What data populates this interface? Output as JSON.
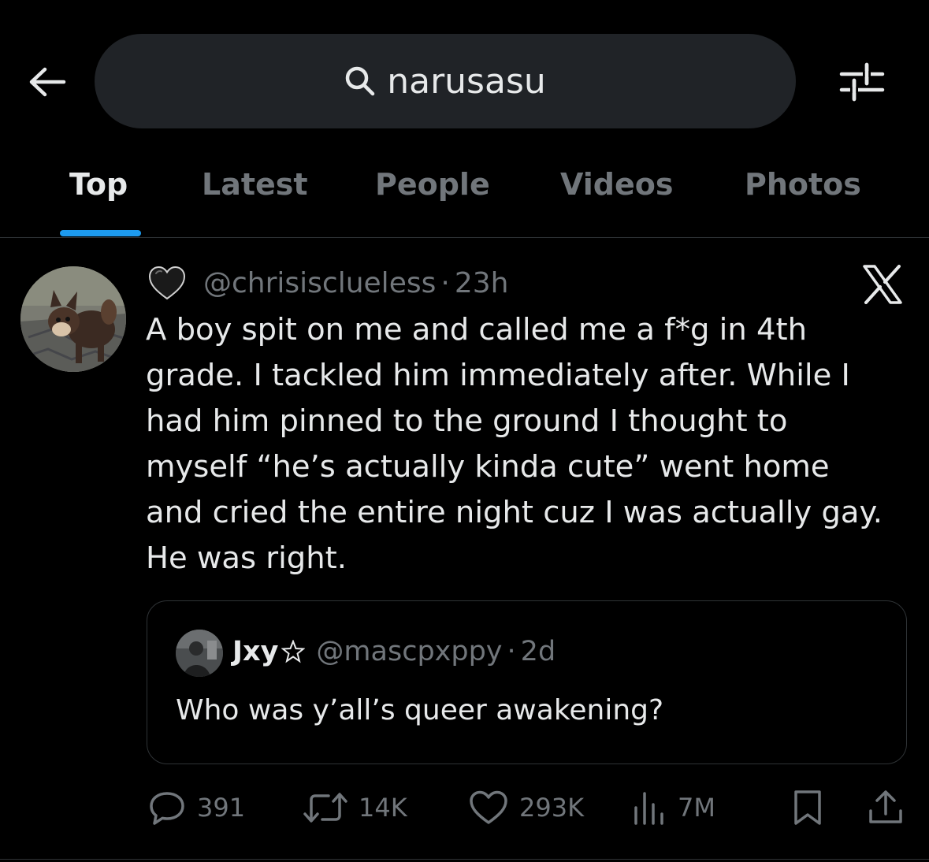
{
  "header": {
    "search_query": "narusasu"
  },
  "tabs": [
    {
      "label": "Top",
      "active": true
    },
    {
      "label": "Latest",
      "active": false
    },
    {
      "label": "People",
      "active": false
    },
    {
      "label": "Videos",
      "active": false
    },
    {
      "label": "Photos",
      "active": false
    }
  ],
  "tweet": {
    "name_emoji": "black-heart",
    "handle": "@chrisisclueless",
    "separator": "·",
    "time": "23h",
    "text_lines": [
      "A boy spit on me and called me a f*g in 4th",
      "grade. I tackled him immediately after. While I",
      "had him pinned to the ground I thought to",
      "myself “he’s actually kinda cute” went home",
      "and cried the entire night cuz I was actually gay.",
      "He was right."
    ],
    "quote": {
      "name": "Jxy",
      "name_icon": "star-outline",
      "handle": "@mascpxppy",
      "separator": "·",
      "time": "2d",
      "text": "Who was y’all’s queer awakening?"
    },
    "stats": {
      "replies": "391",
      "reposts": "14K",
      "likes": "293K",
      "views": "7M"
    }
  },
  "colors": {
    "background": "#000000",
    "text": "#e7e9ea",
    "muted": "#71767b",
    "accent": "#1d9bf0",
    "border": "#2f3336",
    "search_bg": "#202327"
  }
}
